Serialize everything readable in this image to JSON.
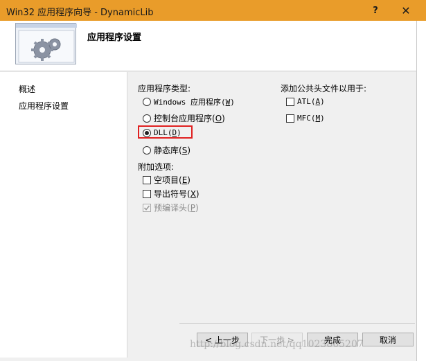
{
  "window": {
    "title": "Win32 应用程序向导 - DynamicLib",
    "help_glyph": "?",
    "close_glyph": "✕",
    "titlebar_color": "#e99c2a"
  },
  "header": {
    "icon": "gears-window-icon",
    "title": "应用程序设置"
  },
  "nav": {
    "items": [
      "概述",
      "应用程序设置"
    ]
  },
  "app_type": {
    "label": "应用程序类型:",
    "options": [
      {
        "pre": "Windows 应用程序(",
        "key": "W",
        "post": ")",
        "selected": false
      },
      {
        "pre": "控制台应用程序(",
        "key": "O",
        "post": ")",
        "selected": false
      },
      {
        "pre": "DLL(",
        "key": "D",
        "post": ")",
        "selected": true
      },
      {
        "pre": "静态库(",
        "key": "S",
        "post": ")",
        "selected": false
      }
    ]
  },
  "extra": {
    "label": "附加选项:",
    "options": [
      {
        "pre": "空项目(",
        "key": "E",
        "post": ")",
        "checked": false,
        "enabled": true
      },
      {
        "pre": "导出符号(",
        "key": "X",
        "post": ")",
        "checked": false,
        "enabled": true
      },
      {
        "pre": "预编译头(",
        "key": "P",
        "post": ")",
        "checked": true,
        "enabled": false
      }
    ]
  },
  "common_headers": {
    "label": "添加公共头文件以用于:",
    "options": [
      {
        "pre": "ATL(",
        "key": "A",
        "post": ")",
        "checked": false
      },
      {
        "pre": "MFC(",
        "key": "M",
        "post": ")",
        "checked": false
      }
    ]
  },
  "buttons": {
    "prev": "< 上一步",
    "next": "下一步 >",
    "finish": "完成",
    "cancel": "取消"
  },
  "watermark": "http://blog.csdn.net/qq1023865207",
  "highlight_color": "#e02020"
}
